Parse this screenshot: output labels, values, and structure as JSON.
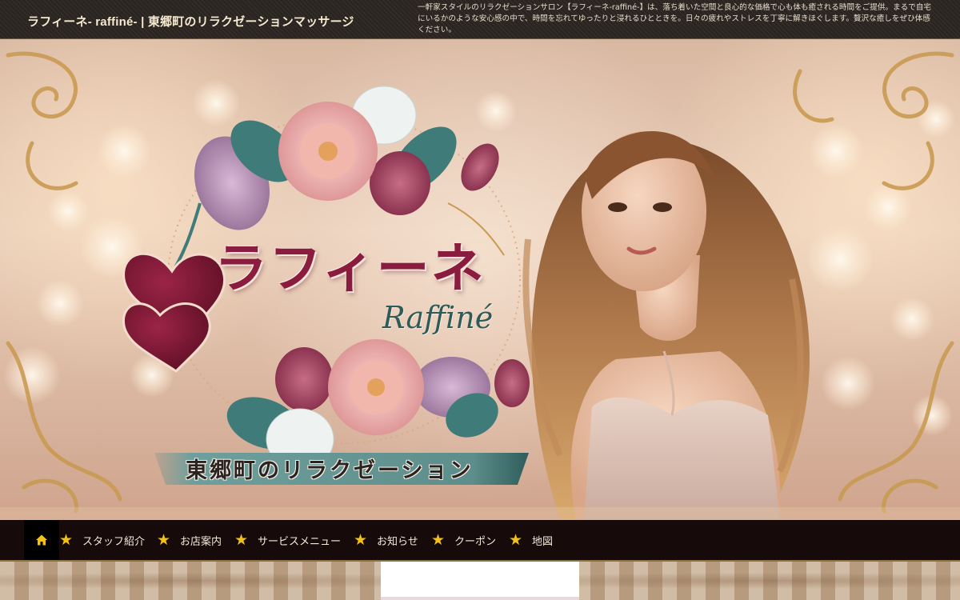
{
  "header": {
    "site_title": "ラフィーネ- raffiné- | 東郷町のリラクゼーションマッサージ",
    "description": "一軒家スタイルのリラクゼーションサロン【ラフィーネ-raffiné-】は、落ち着いた空間と良心的な価格で心も体も癒される時間をご提供。まるで自宅にいるかのような安心感の中で、時間を忘れてゆったりと浸れるひとときを。日々の疲れやストレスを丁寧に解きほぐします。贅沢な癒しをぜひ体感ください。"
  },
  "hero": {
    "logo_kana": "ラフィーネ",
    "logo_latin": "Raffiné",
    "tagline": "東郷町のリラクゼーション"
  },
  "nav": {
    "home_icon": "home-icon",
    "items": [
      {
        "label": "スタッフ紹介"
      },
      {
        "label": "お店案内"
      },
      {
        "label": "サービスメニュー"
      },
      {
        "label": "お知らせ"
      },
      {
        "label": "クーポン"
      },
      {
        "label": "地図"
      }
    ],
    "star_icon": "star-icon"
  },
  "colors": {
    "header_bg": "#2b2522",
    "nav_bg": "#160b0a",
    "star": "#f2c21b",
    "logo_kana": "#8a1d3f",
    "logo_latin": "#2e5a58",
    "tagline_band": "#5d8e8b"
  }
}
